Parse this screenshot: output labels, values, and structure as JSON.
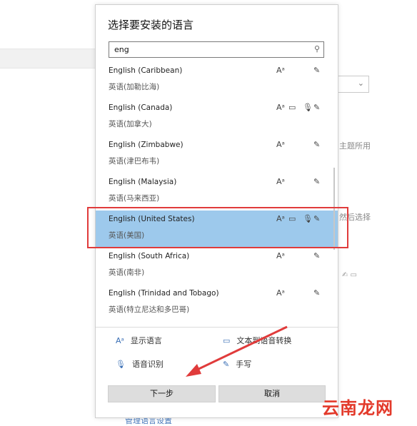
{
  "background": {
    "text_theme_fragment": "主题所用",
    "text_then_select_fragment": "然后选择",
    "bottom_link_fragment": "管理语言设置",
    "select_chevron": "⌄"
  },
  "dialog": {
    "title": "选择要安装的语言",
    "search": {
      "value": "eng",
      "icon": "search-icon"
    },
    "languages": [
      {
        "name": "English (Caribbean)",
        "native": "英语(加勒比海)",
        "features": [
          "display",
          "handwriting"
        ],
        "selected": false
      },
      {
        "name": "English (Canada)",
        "native": "英语(加拿大)",
        "features": [
          "display",
          "tts",
          "speech",
          "handwriting"
        ],
        "selected": false
      },
      {
        "name": "English (Zimbabwe)",
        "native": "英语(津巴布韦)",
        "features": [
          "display",
          "handwriting"
        ],
        "selected": false
      },
      {
        "name": "English (Malaysia)",
        "native": "英语(马来西亚)",
        "features": [
          "display",
          "handwriting"
        ],
        "selected": false
      },
      {
        "name": "English (United States)",
        "native": "英语(美国)",
        "features": [
          "display",
          "tts",
          "speech",
          "handwriting"
        ],
        "selected": true
      },
      {
        "name": "English (South Africa)",
        "native": "英语(南非)",
        "features": [
          "display",
          "handwriting"
        ],
        "selected": false
      },
      {
        "name": "English (Trinidad and Tobago)",
        "native": "英语(特立尼达和多巴哥)",
        "features": [
          "display",
          "handwriting"
        ],
        "selected": false
      }
    ],
    "legend": {
      "display": "显示语言",
      "tts": "文本到语音转换",
      "speech": "语音识别",
      "handwriting": "手写"
    },
    "buttons": {
      "next": "下一步",
      "cancel": "取消"
    }
  },
  "watermark": "云南龙网",
  "colors": {
    "selected_row": "#9dc9ec",
    "annotation_red": "#e03b3b",
    "accent_icon": "#3a6fb5"
  }
}
